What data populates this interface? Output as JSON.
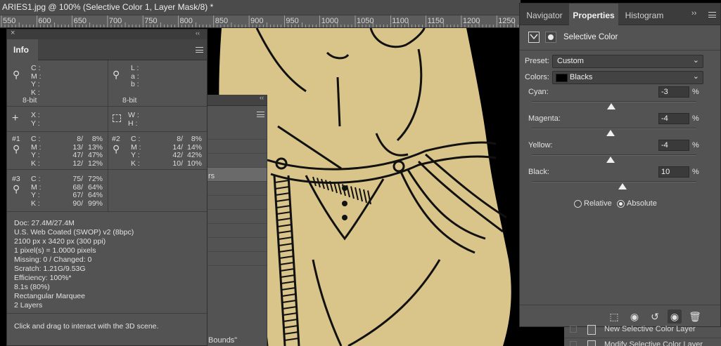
{
  "document": {
    "tab_title": "ARIES1.jpg @ 100% (Selective Color 1, Layer Mask/8) *",
    "ruler_ticks": [
      "550",
      "600",
      "650",
      "700",
      "750",
      "800",
      "850",
      "900",
      "950",
      "1000",
      "1050",
      "1100",
      "1150",
      "1200",
      "1250"
    ]
  },
  "layers_panel": {
    "partial_text_1": "rs",
    "partial_text_2": "Bounds\""
  },
  "info_panel": {
    "tab": "Info",
    "readout_cmyk": {
      "labels": "C :\nM :\nY :\nK :",
      "bit": "8-bit"
    },
    "readout_lab": {
      "labels": "L :\na :\nb :",
      "bit": "8-bit"
    },
    "xy_labels": "X :\nY :",
    "wh_labels": "W :\nH :",
    "samplers": [
      {
        "id": "#1",
        "labels": "C :\nM :\nY :\nK :",
        "vals": "8/\n13/\n47/\n12/",
        "pcts": "8%\n13%\n47%\n12%"
      },
      {
        "id": "#2",
        "labels": "C :\nM :\nY :\nK :",
        "vals": "8/\n14/\n42/\n10/",
        "pcts": "8%\n14%\n42%\n10%"
      },
      {
        "id": "#3",
        "labels": "C :\nM :\nY :\nK :",
        "vals": "75/\n68/\n67/\n90/",
        "pcts": "72%\n64%\n64%\n99%"
      }
    ],
    "doc_info": [
      "Doc: 27.4M/27.4M",
      "U.S. Web Coated (SWOP) v2 (8bpc)",
      "2100 px x 3420 px (300 ppi)",
      "1 pixel(s) = 1.0000 pixels",
      "Missing: 0 / Changed: 0",
      "Scratch: 1.21G/9.53G",
      "Efficiency: 100%*",
      "8.1s (80%)",
      "Rectangular Marquee",
      "2 Layers"
    ],
    "hint": "Click and drag to interact with the 3D scene."
  },
  "properties_panel": {
    "tabs": [
      "Navigator",
      "Properties",
      "Histogram"
    ],
    "active_tab": "Properties",
    "title": "Selective Color",
    "preset_label": "Preset:",
    "preset_value": "Custom",
    "colors_label": "Colors:",
    "colors_value": "Blacks",
    "sliders": [
      {
        "label": "Cyan:",
        "value": "-3",
        "unit": "%"
      },
      {
        "label": "Magenta:",
        "value": "-4",
        "unit": "%"
      },
      {
        "label": "Yellow:",
        "value": "-4",
        "unit": "%"
      },
      {
        "label": "Black:",
        "value": "10",
        "unit": "%"
      }
    ],
    "mode_relative": "Relative",
    "mode_absolute": "Absolute",
    "selected_mode": "Absolute"
  },
  "history": {
    "rows": [
      "New Selective Color Layer",
      "Modify Selective Color Layer"
    ]
  },
  "colors": {
    "panel_bg": "#535353",
    "paper": "#d9c48a",
    "ink": "#111111"
  }
}
